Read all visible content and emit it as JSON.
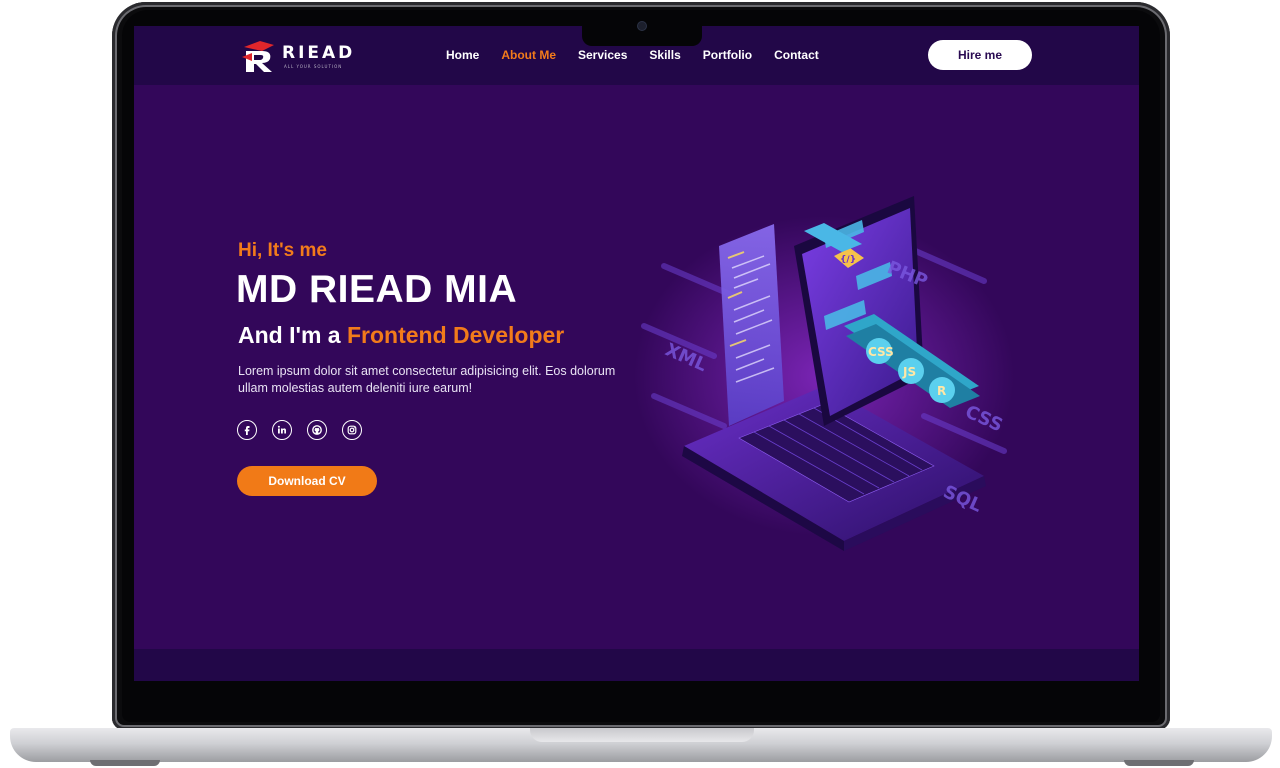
{
  "nav": {
    "logo_text": "RIEAD",
    "logo_tagline": "ALL YOUR SOLUTION",
    "links": [
      {
        "label": "Home",
        "active": false
      },
      {
        "label": "About Me",
        "active": true
      },
      {
        "label": "Services",
        "active": false
      },
      {
        "label": "Skills",
        "active": false
      },
      {
        "label": "Portfolio",
        "active": false
      },
      {
        "label": "Contact",
        "active": false
      }
    ],
    "hire_label": "Hire me"
  },
  "hero": {
    "greeting": "Hi, It's me",
    "name": "MD RIEAD MIA",
    "role_prefix": "And I'm a ",
    "role_highlight": "Frontend Developer",
    "description": "Lorem ipsum dolor sit amet consectetur adipisicing elit. Eos dolorum ullam molestias autem deleniti iure earum!",
    "socials": [
      "facebook-icon",
      "linkedin-icon",
      "github-icon",
      "instagram-icon"
    ],
    "cv_label": "Download CV"
  },
  "illustration": {
    "tags": [
      "PHP",
      "XML",
      "CSS",
      "SQL",
      "CSS",
      "JS",
      "R"
    ]
  },
  "colors": {
    "accent": "#f27b1b",
    "screen_bg": "#33075a",
    "nav_bg": "#220748"
  }
}
